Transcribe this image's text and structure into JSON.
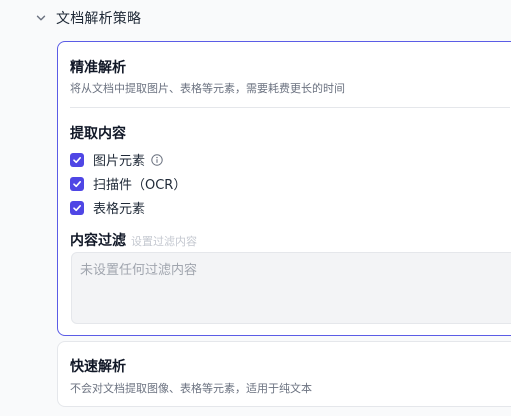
{
  "section": {
    "title": "文档解析策略"
  },
  "precise": {
    "title": "精准解析",
    "description": "将从文档中提取图片、表格等元素，需要耗费更长的时间",
    "extract_title": "提取内容",
    "options": [
      {
        "label": "图片元素",
        "checked": true
      },
      {
        "label": "扫描件（OCR）",
        "checked": true
      },
      {
        "label": "表格元素",
        "checked": true
      }
    ],
    "filter_label": "内容过滤",
    "filter_hint": "设置过滤内容",
    "filter_placeholder": "未设置任何过滤内容"
  },
  "fast": {
    "title": "快速解析",
    "description": "不会对文档提取图像、表格等元素，适用于纯文本"
  },
  "icons": {
    "section_toggle": "chevron-down-icon",
    "checkbox": "check-icon",
    "info": "info-icon"
  },
  "colors": {
    "accent": "#4f46e5",
    "active_border": "#5b5ce6"
  }
}
